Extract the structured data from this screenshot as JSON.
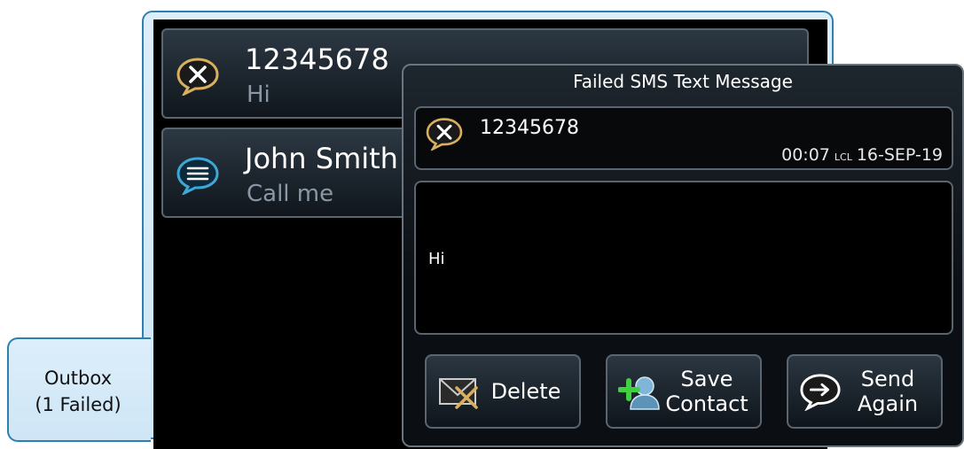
{
  "sidebar_tab": {
    "label": "Outbox\n(1 Failed)"
  },
  "messages": [
    {
      "title": "12345678",
      "preview": "Hi",
      "icon": "failed-message-icon"
    },
    {
      "title": "John Smith",
      "preview": "Call me",
      "icon": "message-icon"
    }
  ],
  "dialog": {
    "title": "Failed SMS Text Message",
    "recipient": "12345678",
    "time": "00:07",
    "time_zone": "LCL",
    "date": "16-SEP-19",
    "body": "Hi",
    "buttons": {
      "delete": "Delete",
      "save_contact": "Save\nContact",
      "send_again": "Send\nAgain"
    }
  },
  "colors": {
    "accent": "#2f7fb0",
    "failed_icon": "#d9b060",
    "message_icon": "#3fa7d6"
  }
}
